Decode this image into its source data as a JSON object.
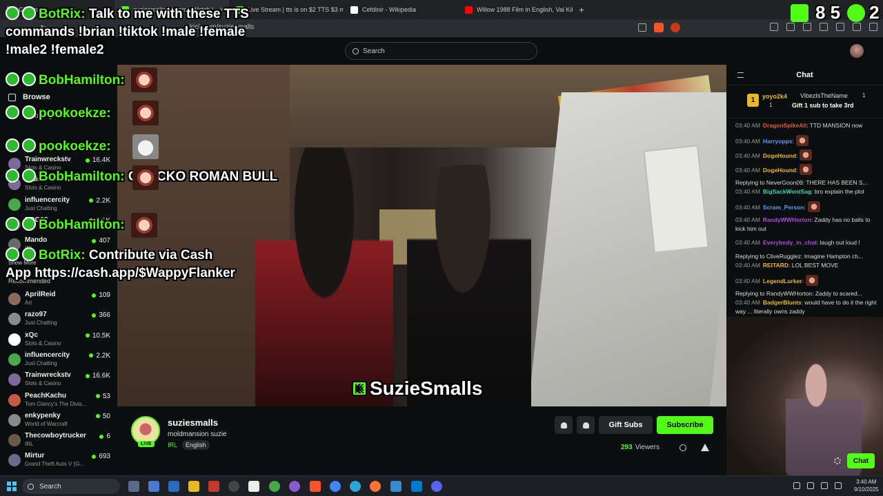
{
  "browser": {
    "tabs": [
      {
        "title": "GIF Ima",
        "color": "#9b59b6"
      },
      {
        "title": "suziesmalls Stream - Watch L",
        "color": "#53fc18"
      },
      {
        "title": "Live Stream | tts is on $2 TTS $3 me",
        "color": "#53fc18"
      },
      {
        "title": "Cefdinir - Wikipedia",
        "color": "#ffffff"
      },
      {
        "title": "Willow 1988 Film in English, Val Kilme",
        "color": "#ff0000"
      }
    ],
    "new_tab": "+",
    "url": "kick.com/suziesmalls"
  },
  "header": {
    "search_placeholder": "Search"
  },
  "sidebar": {
    "browse_label": "Browse",
    "following_label": "Following",
    "following": [
      {
        "name": "Trainwreckstv",
        "category": "Slots & Casino",
        "viewers": "16.4K",
        "color": "#7c6a9a"
      },
      {
        "name": "Trainwreckstv",
        "category": "Slots & Casino",
        "viewers": "",
        "color": "#7c6a9a"
      },
      {
        "name": "influencercity",
        "category": "Just Chatting",
        "viewers": "2.2K",
        "color": "#4aa84a"
      },
      {
        "name": "DDG68",
        "category": "",
        "viewers": "1.1K",
        "color": "#555"
      },
      {
        "name": "Mando",
        "category": "IRL",
        "viewers": "407",
        "color": "#6a6a6a"
      }
    ],
    "show_more": "Show More",
    "recommended_label": "Recommended",
    "recommended": [
      {
        "name": "AprilReid",
        "category": "Art",
        "viewers": "109",
        "color": "#8a6a5a"
      },
      {
        "name": "razo97",
        "category": "Just Chatting",
        "viewers": "366",
        "color": "#8a8a8a"
      },
      {
        "name": "xQc",
        "category": "Slots & Casino",
        "viewers": "10.5K",
        "color": "#ffffff"
      },
      {
        "name": "influencercity",
        "category": "Just Chatting",
        "viewers": "2.2K",
        "color": "#4aa84a"
      },
      {
        "name": "Trainwreckstv",
        "category": "Slots & Casino",
        "viewers": "16.6K",
        "color": "#7c6a9a"
      },
      {
        "name": "PeachKachu",
        "category": "Tom Clancy's The Divis...",
        "viewers": "53",
        "color": "#c45a4a"
      },
      {
        "name": "enkypenky",
        "category": "World of Warcraft",
        "viewers": "50",
        "color": "#8a8a8a"
      },
      {
        "name": "Thecowboytrucker",
        "category": "IRL",
        "viewers": "6",
        "color": "#6a5a4a"
      },
      {
        "name": "Mirtur",
        "category": "Grand Theft Auto V (G...",
        "viewers": "693",
        "color": "#6a6a8a"
      }
    ]
  },
  "overlay": {
    "counter_left": "8 5",
    "counter_right": "2",
    "messages": [
      {
        "user": "BotRix:",
        "text": "Talk to me with these TTS commands !brian !tiktok !male !female !male2 !female2"
      },
      {
        "user": "BobHamilton:",
        "text": ""
      },
      {
        "user": "pookoekze:",
        "text": ""
      },
      {
        "user": "pookoekze:",
        "text": ""
      },
      {
        "user": "BobHamilton:",
        "text": "GRECKO ROMAN BULL"
      },
      {
        "user": "BobHamilton:",
        "text": ""
      },
      {
        "user": "BotRix:",
        "text": "Contribute via Cash App https://cash.app/$WappyFlanker"
      }
    ]
  },
  "video": {
    "watermark": "SuzieSmalls",
    "watermark_icon": "K"
  },
  "stream": {
    "streamer": "suziesmalls",
    "title": "moldmansion suzie",
    "live_badge": "LIVE",
    "category": "IRL",
    "language": "English",
    "gift_subs": "Gift Subs",
    "subscribe": "Subscribe",
    "viewer_count": "293",
    "viewers_label": "Viewers"
  },
  "chat": {
    "title": "Chat",
    "pinned": {
      "rank": "1",
      "user1": "yoyo2k4",
      "count1": "1",
      "user2": "VibezIsTheName",
      "count2": "1",
      "gift_text": "Gift 1 sub to take 3rd"
    },
    "messages": [
      {
        "time": "03:40 AM",
        "user": "DragonSpikeAll",
        "text": ": TTD MANSION now",
        "color": "#e05a3a",
        "emote": false,
        "reply": ""
      },
      {
        "time": "03:40 AM",
        "user": "Harryopps",
        "text": ":",
        "color": "#5a9aff",
        "emote": true,
        "reply": ""
      },
      {
        "time": "03:40 AM",
        "user": "DogeHound",
        "text": ":",
        "color": "#e8b923",
        "emote": true,
        "reply": ""
      },
      {
        "time": "03:40 AM",
        "user": "DogeHound",
        "text": ":",
        "color": "#e8b923",
        "emote": true,
        "reply": ""
      },
      {
        "time": "03:40 AM",
        "user": "BigSackWontSag",
        "text": ": bro explain the plot",
        "color": "#3ad6b0",
        "emote": false,
        "reply": "Replying to NeverGoon09: THERE HAS BEEN S..."
      },
      {
        "time": "03:40 AM",
        "user": "Scram_Person",
        "text": ":",
        "color": "#5a9aff",
        "emote": true,
        "reply": ""
      },
      {
        "time": "03:40 AM",
        "user": "RandyWWHorton",
        "text": ": Zaddy has no balls to kick him out",
        "color": "#b04ae0",
        "emote": false,
        "reply": ""
      },
      {
        "time": "03:40 AM",
        "user": "Everybody_in_chat",
        "text": ": laugh out loud !",
        "color": "#b04ae0",
        "emote": false,
        "reply": ""
      },
      {
        "time": "03:40 AM",
        "user": "REITARD",
        "text": ": LOL BEST MOVE",
        "color": "#e8b923",
        "emote": false,
        "reply": "Replying to CliveRugglez: Imagine Hampton ch..."
      },
      {
        "time": "03:40 AM",
        "user": "LegendLurker",
        "text": ":",
        "color": "#e8b923",
        "emote": true,
        "reply": ""
      },
      {
        "time": "03:40 AM",
        "user": "BadgerBlunts",
        "text": ": would have to do it the right way ... literally owns zaddy",
        "color": "#e8b923",
        "emote": false,
        "reply": "Replying to RandyWWHorton: Zaddy to scared..."
      }
    ],
    "chat_button": "Chat"
  },
  "taskbar": {
    "search_placeholder": "Search",
    "time": "3:40 AM",
    "date": "9/10/2025"
  }
}
